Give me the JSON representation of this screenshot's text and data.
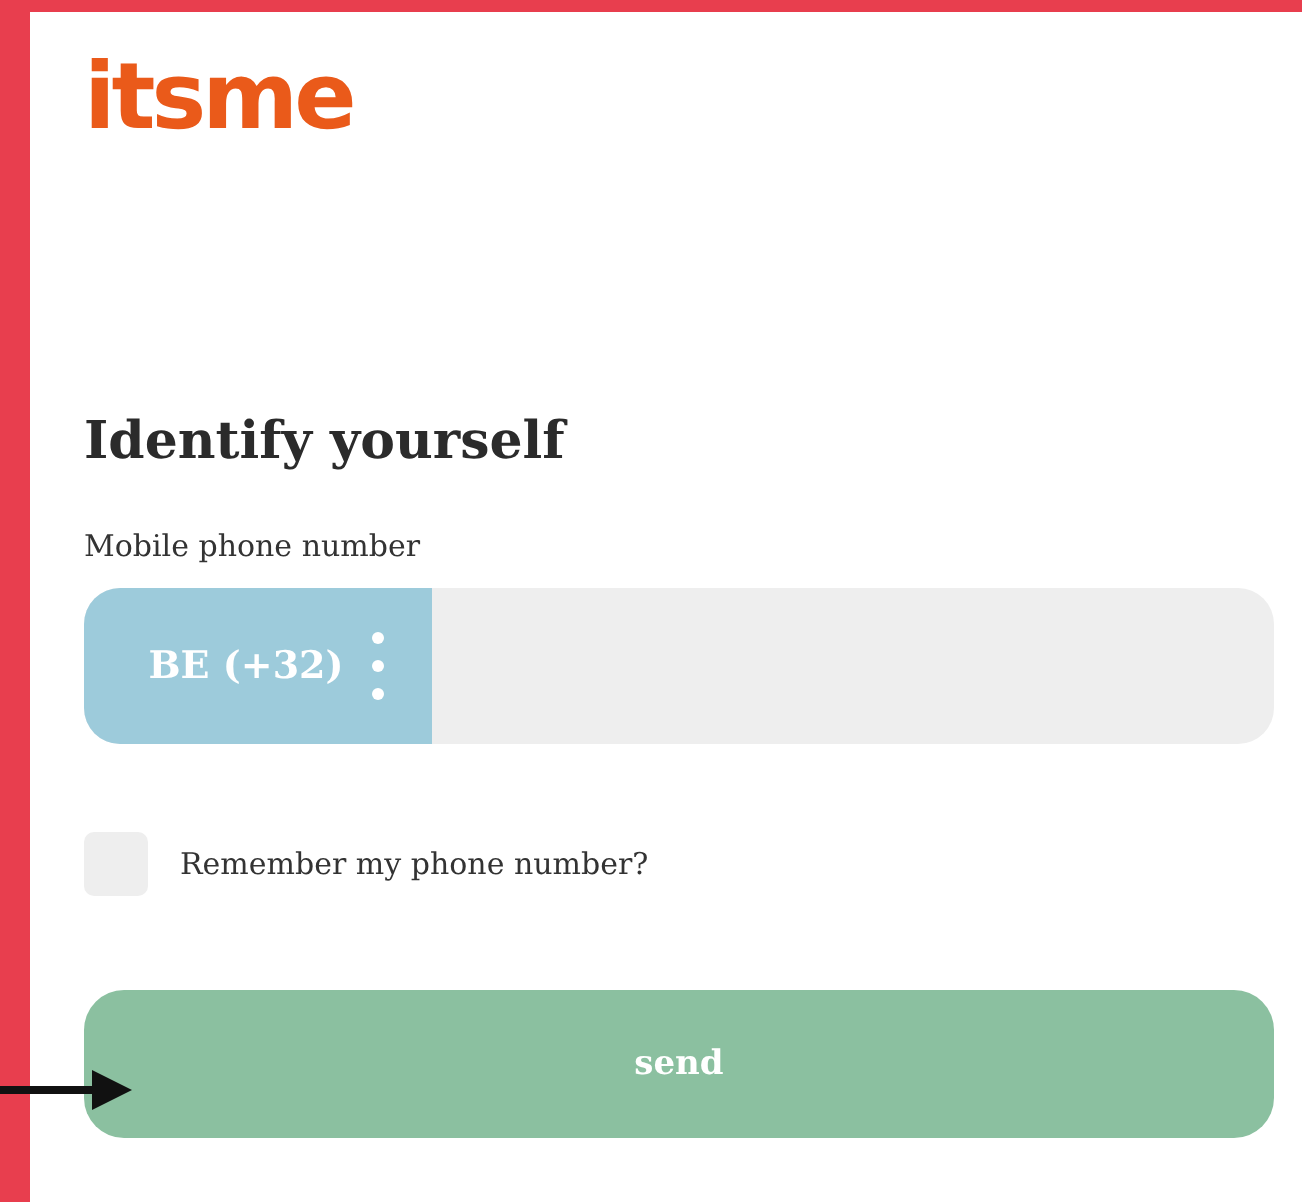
{
  "logo": "itsme",
  "heading": "Identify yourself",
  "phone": {
    "label": "Mobile phone number",
    "country_code": "BE (+32)"
  },
  "remember": {
    "label": "Remember my phone number?",
    "checked": false
  },
  "send_button": "send"
}
